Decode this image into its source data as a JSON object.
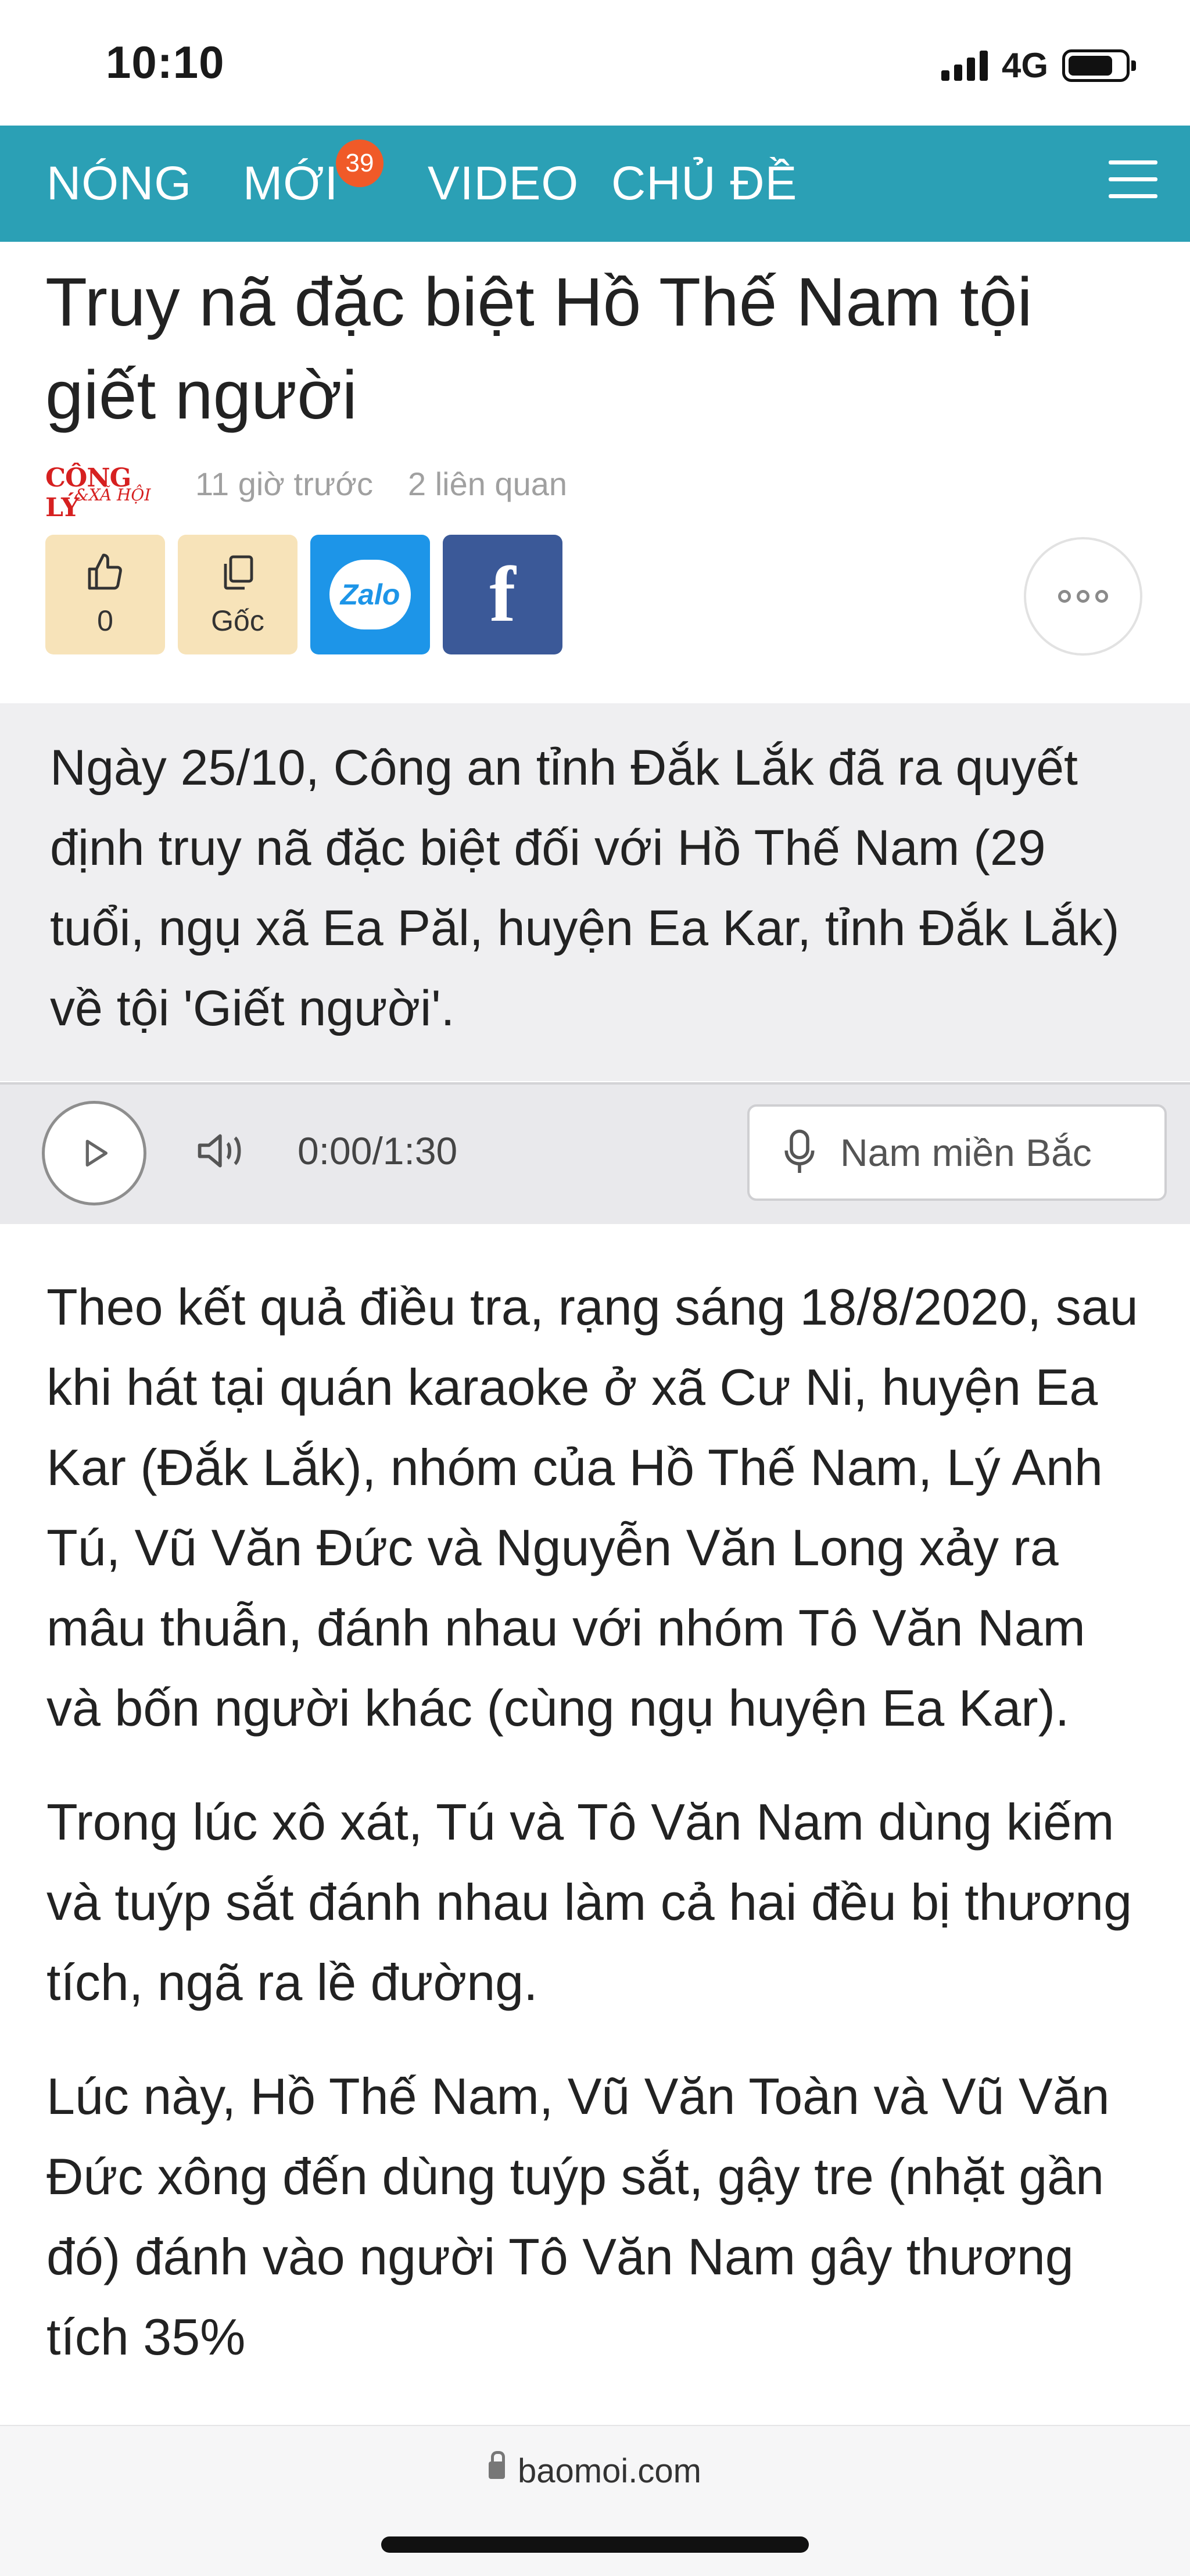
{
  "status_bar": {
    "time": "10:10",
    "network": "4G"
  },
  "nav": {
    "items": [
      "NÓNG",
      "MỚI",
      "VIDEO",
      "CHỦ ĐỀ"
    ],
    "badge_count": "39"
  },
  "article": {
    "title": "Truy nã đặc biệt Hồ Thế Nam tội giết người",
    "source_logo_line1": "CÔNG LÝ",
    "source_logo_line2": "&XÃ HỘI",
    "time_ago": "11 giờ trước",
    "related": "2 liên quan",
    "summary": "Ngày 25/10, Công an tỉnh Đắk Lắk đã ra quyết định truy nã đặc biệt đối với Hồ Thế Nam (29 tuổi, ngụ xã Ea Păl, huyện Ea Kar, tỉnh Đắk Lắk) về tội 'Giết người'.",
    "paragraphs": [
      "Theo kết quả điều tra, rạng sáng 18/8/2020, sau khi hát tại quán karaoke ở xã Cư Ni, huyện Ea Kar (Đắk Lắk), nhóm của Hồ Thế Nam, Lý Anh Tú, Vũ Văn Đức và Nguyễn Văn Long xảy ra mâu thuẫn, đánh nhau với nhóm Tô Văn Nam và bốn người khác (cùng ngụ huyện Ea Kar).",
      "Trong lúc xô xát, Tú và Tô Văn Nam dùng kiếm và tuýp sắt đánh nhau làm cả hai đều bị thương tích, ngã ra lề đường.",
      "Lúc này, Hồ Thế Nam, Vũ Văn Toàn và Vũ Văn Đức xông đến dùng tuýp sắt, gậy tre (nhặt gần đó) đánh vào người Tô Văn Nam gây thương tích 35%"
    ]
  },
  "actions": {
    "like_count": "0",
    "source_label": "Gốc",
    "zalo_label": "Zalo",
    "facebook_label": "f"
  },
  "player": {
    "current": "0:00",
    "duration": "/1:30",
    "voice": "Nam miền Bắc"
  },
  "browser": {
    "url": "baomoi.com"
  },
  "colors": {
    "nav_bg": "#2ba0b5",
    "badge": "#f05a28",
    "zalo": "#1d95e8",
    "facebook": "#3b5998"
  }
}
